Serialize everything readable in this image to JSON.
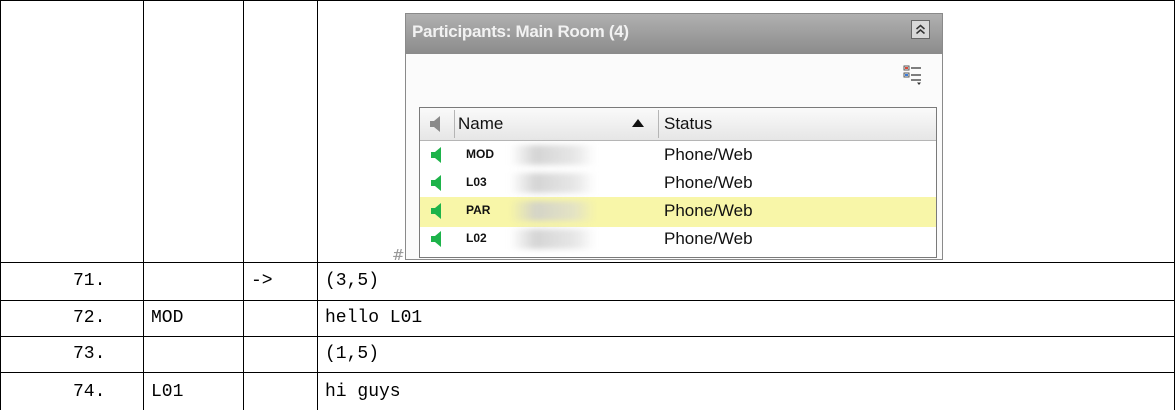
{
  "panel": {
    "title": "Participants: Main Room (4)",
    "columns": {
      "name": "Name",
      "status": "Status"
    },
    "participants": [
      {
        "name": "MOD",
        "status": "Phone/Web",
        "selected": false
      },
      {
        "name": "L03",
        "status": "Phone/Web",
        "selected": false
      },
      {
        "name": "PAR",
        "status": "Phone/Web",
        "selected": true
      },
      {
        "name": "L02",
        "status": "Phone/Web",
        "selected": false
      }
    ],
    "speaker_color": "#1db34a",
    "highlight_color": "#f8f6a8"
  },
  "marker": "#",
  "transcript": [
    {
      "num": "71.",
      "speaker": "",
      "arrow": "->",
      "text": "(3,5)"
    },
    {
      "num": "72.",
      "speaker": "MOD",
      "arrow": "",
      "text": "hello L01"
    },
    {
      "num": "73.",
      "speaker": "",
      "arrow": "",
      "text": "(1,5)"
    },
    {
      "num": "74.",
      "speaker": "L01",
      "arrow": "",
      "text": "hi guys"
    }
  ]
}
